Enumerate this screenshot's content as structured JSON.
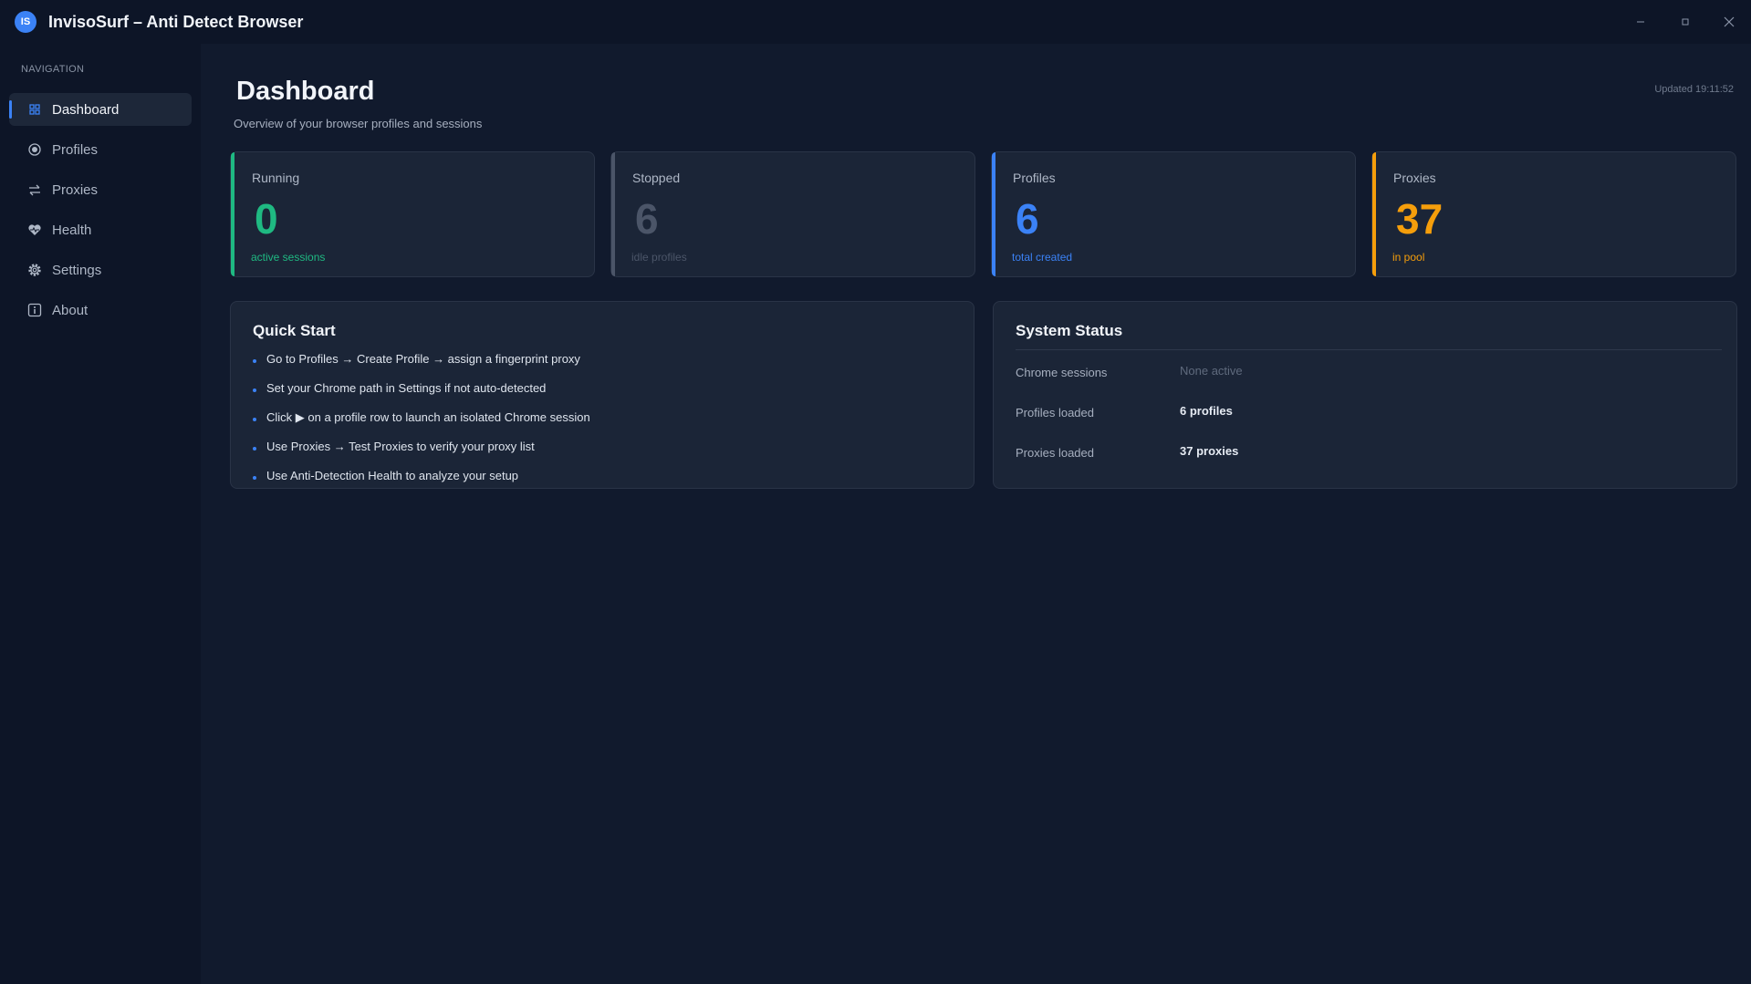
{
  "app": {
    "logo_text": "IS",
    "title": "InvisoSurf – Anti Detect Browser"
  },
  "window_controls": [
    "minimize-icon",
    "maximize-icon",
    "close-icon"
  ],
  "sidebar": {
    "heading": "NAVIGATION",
    "items": [
      {
        "label": "Dashboard",
        "icon": "dashboard-grid-icon",
        "active": true
      },
      {
        "label": "Profiles",
        "icon": "profile-circle-icon"
      },
      {
        "label": "Proxies",
        "icon": "arrows-swap-icon"
      },
      {
        "label": "Health",
        "icon": "heart-icon"
      },
      {
        "label": "Settings",
        "icon": "gear-icon"
      },
      {
        "label": "About",
        "icon": "info-icon"
      }
    ]
  },
  "header": {
    "title": "Dashboard",
    "subtitle": "Overview of your browser profiles and sessions",
    "updated": "Updated 19:11:52"
  },
  "stats": [
    {
      "label": "Running",
      "value": "0",
      "sub": "active sessions",
      "color": "#1fb982"
    },
    {
      "label": "Stopped",
      "value": "6",
      "sub": "idle profiles",
      "color": "#4b5568"
    },
    {
      "label": "Profiles",
      "value": "6",
      "sub": "total created",
      "color": "#3b82f6"
    },
    {
      "label": "Proxies",
      "value": "37",
      "sub": "in pool",
      "color": "#f59e0b"
    }
  ],
  "quick_start": {
    "title": "Quick Start",
    "items": [
      "Go to Profiles → Create Profile → assign a fingerprint  proxy",
      "Set your Chrome path in Settings if not auto-detected",
      "Click ▶ on a profile row to launch an isolated Chrome session",
      "Use Proxies → Test Proxies to verify your proxy list",
      "Use Anti-Detection Health to analyze your setup"
    ]
  },
  "system_status": {
    "title": "System Status",
    "rows": [
      {
        "key": "Chrome sessions",
        "value": "None active",
        "muted": true
      },
      {
        "key": "Profiles loaded",
        "value": "6 profiles"
      },
      {
        "key": "Proxies loaded",
        "value": "37 proxies"
      }
    ]
  }
}
